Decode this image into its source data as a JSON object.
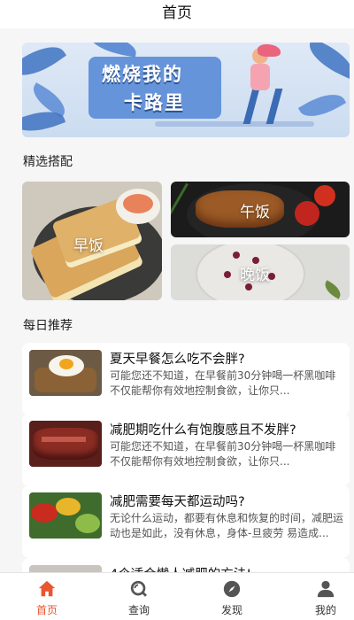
{
  "header": {
    "title": "首页"
  },
  "banner": {
    "line1": "燃烧我的",
    "line2": "卡路里"
  },
  "featured": {
    "section_title": "精选搭配",
    "tiles": [
      {
        "label": "早饭"
      },
      {
        "label": "午饭"
      },
      {
        "label": "晚饭"
      }
    ]
  },
  "daily": {
    "section_title": "每日推荐",
    "cards": [
      {
        "title": "夏天早餐怎么吃不会胖?",
        "desc": "可能您还不知道，在早餐前30分钟喝一杯黑咖啡不仅能帮你有效地控制食欲，让你只..."
      },
      {
        "title": "减肥期吃什么有饱腹感且不发胖?",
        "desc": "可能您还不知道，在早餐前30分钟喝一杯黑咖啡不仅能帮你有效地控制食欲，让你只..."
      },
      {
        "title": "减肥需要每天都运动吗?",
        "desc": "无论什么运动，都要有休息和恢复的时间，减肥运动也是如此，没有休息，身体-旦疲劳 易造成..."
      },
      {
        "title": "4个适合懒人减肥的方法!",
        "desc": ""
      }
    ]
  },
  "tabbar": {
    "tabs": [
      {
        "label": "首页",
        "icon": "home-icon",
        "active": true
      },
      {
        "label": "查询",
        "icon": "search-icon",
        "active": false
      },
      {
        "label": "发现",
        "icon": "compass-icon",
        "active": false
      },
      {
        "label": "我的",
        "icon": "user-icon",
        "active": false
      }
    ]
  },
  "colors": {
    "accent": "#e8572f",
    "inactive_icon": "#555555",
    "background": "#f6f6f6"
  }
}
